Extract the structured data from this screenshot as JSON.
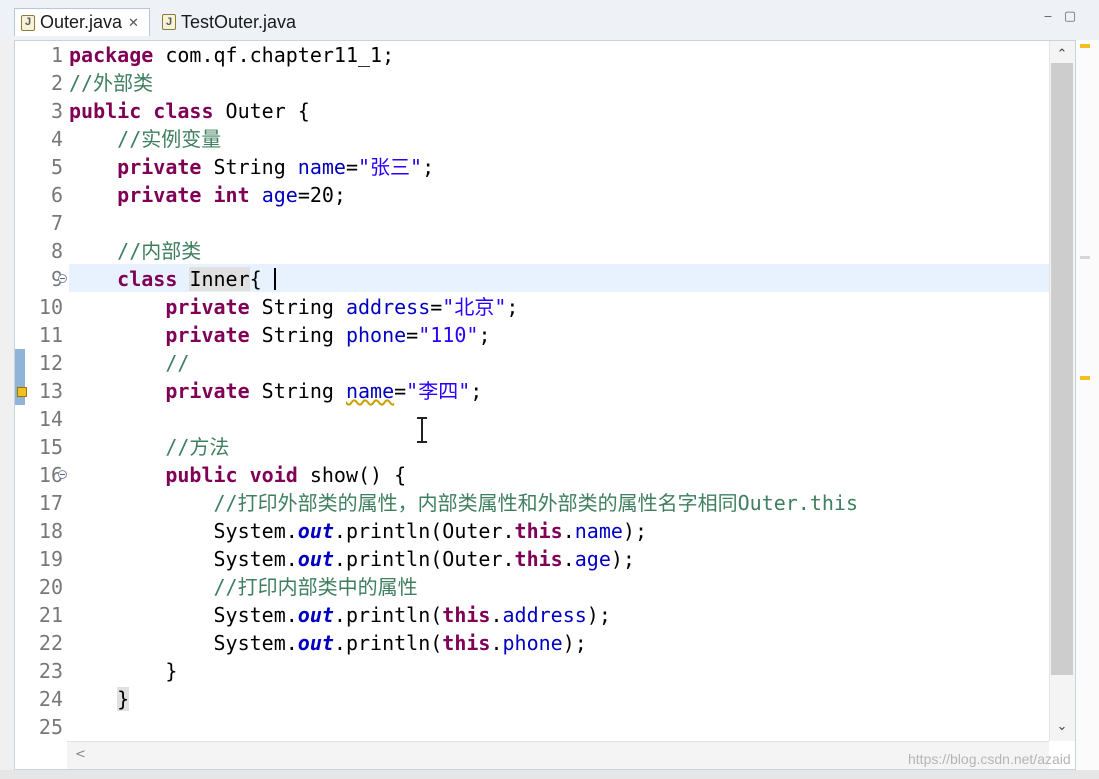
{
  "tabs": [
    {
      "label": "Outer.java",
      "active": true,
      "close_glyph": "✕"
    },
    {
      "label": "TestOuter.java",
      "active": false
    }
  ],
  "window_controls": {
    "minimize": "‒",
    "maximize": "▢"
  },
  "editor": {
    "line_numbers": [
      "1",
      "2",
      "3",
      "4",
      "5",
      "6",
      "7",
      "8",
      "9",
      "10",
      "11",
      "12",
      "13",
      "14",
      "15",
      "16",
      "17",
      "18",
      "19",
      "20",
      "21",
      "22",
      "23",
      "24",
      "25"
    ],
    "current_line": 9,
    "lines": [
      [
        {
          "t": "package",
          "c": "kw"
        },
        {
          "t": " com.qf.chapter11_1;",
          "c": ""
        }
      ],
      [
        {
          "t": "//外部类",
          "c": "cm"
        }
      ],
      [
        {
          "t": "public",
          "c": "kw"
        },
        {
          "t": " ",
          "c": ""
        },
        {
          "t": "class",
          "c": "kw"
        },
        {
          "t": " Outer {",
          "c": ""
        }
      ],
      [
        {
          "t": "    ",
          "c": ""
        },
        {
          "t": "//实例变量",
          "c": "cm"
        }
      ],
      [
        {
          "t": "    ",
          "c": ""
        },
        {
          "t": "private",
          "c": "kw"
        },
        {
          "t": " String ",
          "c": ""
        },
        {
          "t": "name",
          "c": "fd"
        },
        {
          "t": "=",
          "c": ""
        },
        {
          "t": "\"张三\"",
          "c": "st"
        },
        {
          "t": ";",
          "c": ""
        }
      ],
      [
        {
          "t": "    ",
          "c": ""
        },
        {
          "t": "private",
          "c": "kw"
        },
        {
          "t": " ",
          "c": ""
        },
        {
          "t": "int",
          "c": "kw"
        },
        {
          "t": " ",
          "c": ""
        },
        {
          "t": "age",
          "c": "fd"
        },
        {
          "t": "=20;",
          "c": ""
        }
      ],
      [],
      [
        {
          "t": "    ",
          "c": ""
        },
        {
          "t": "//内部类",
          "c": "cm"
        }
      ],
      [
        {
          "t": "    ",
          "c": ""
        },
        {
          "t": "class",
          "c": "kw"
        },
        {
          "t": " ",
          "c": ""
        },
        {
          "t": "Inner",
          "c": "hl-box"
        },
        {
          "t": "{",
          "c": ""
        }
      ],
      [
        {
          "t": "        ",
          "c": ""
        },
        {
          "t": "private",
          "c": "kw"
        },
        {
          "t": " String ",
          "c": ""
        },
        {
          "t": "address",
          "c": "fd"
        },
        {
          "t": "=",
          "c": ""
        },
        {
          "t": "\"北京\"",
          "c": "st"
        },
        {
          "t": ";",
          "c": ""
        }
      ],
      [
        {
          "t": "        ",
          "c": ""
        },
        {
          "t": "private",
          "c": "kw"
        },
        {
          "t": " String ",
          "c": ""
        },
        {
          "t": "phone",
          "c": "fd"
        },
        {
          "t": "=",
          "c": ""
        },
        {
          "t": "\"110\"",
          "c": "st"
        },
        {
          "t": ";",
          "c": ""
        }
      ],
      [
        {
          "t": "        ",
          "c": ""
        },
        {
          "t": "//",
          "c": "cm"
        }
      ],
      [
        {
          "t": "        ",
          "c": ""
        },
        {
          "t": "private",
          "c": "kw"
        },
        {
          "t": " String ",
          "c": ""
        },
        {
          "t": "name",
          "c": "fd warn"
        },
        {
          "t": "=",
          "c": ""
        },
        {
          "t": "\"李四\"",
          "c": "st"
        },
        {
          "t": ";",
          "c": ""
        }
      ],
      [],
      [
        {
          "t": "        ",
          "c": ""
        },
        {
          "t": "//方法",
          "c": "cm"
        }
      ],
      [
        {
          "t": "        ",
          "c": ""
        },
        {
          "t": "public",
          "c": "kw"
        },
        {
          "t": " ",
          "c": ""
        },
        {
          "t": "void",
          "c": "kw"
        },
        {
          "t": " show() {",
          "c": ""
        }
      ],
      [
        {
          "t": "            ",
          "c": ""
        },
        {
          "t": "//打印外部类的属性，内部类属性和外部类的属性名字相同Outer.this",
          "c": "cm"
        }
      ],
      [
        {
          "t": "            System.",
          "c": ""
        },
        {
          "t": "out",
          "c": "sf"
        },
        {
          "t": ".println(Outer.",
          "c": ""
        },
        {
          "t": "this",
          "c": "kw"
        },
        {
          "t": ".",
          "c": ""
        },
        {
          "t": "name",
          "c": "fd"
        },
        {
          "t": ");",
          "c": ""
        }
      ],
      [
        {
          "t": "            System.",
          "c": ""
        },
        {
          "t": "out",
          "c": "sf"
        },
        {
          "t": ".println(Outer.",
          "c": ""
        },
        {
          "t": "this",
          "c": "kw"
        },
        {
          "t": ".",
          "c": ""
        },
        {
          "t": "age",
          "c": "fd"
        },
        {
          "t": ");",
          "c": ""
        }
      ],
      [
        {
          "t": "            ",
          "c": ""
        },
        {
          "t": "//打印内部类中的属性",
          "c": "cm"
        }
      ],
      [
        {
          "t": "            System.",
          "c": ""
        },
        {
          "t": "out",
          "c": "sf"
        },
        {
          "t": ".println(",
          "c": ""
        },
        {
          "t": "this",
          "c": "kw"
        },
        {
          "t": ".",
          "c": ""
        },
        {
          "t": "address",
          "c": "fd"
        },
        {
          "t": ");",
          "c": ""
        }
      ],
      [
        {
          "t": "            System.",
          "c": ""
        },
        {
          "t": "out",
          "c": "sf"
        },
        {
          "t": ".println(",
          "c": ""
        },
        {
          "t": "this",
          "c": "kw"
        },
        {
          "t": ".",
          "c": ""
        },
        {
          "t": "phone",
          "c": "fd"
        },
        {
          "t": ");",
          "c": ""
        }
      ],
      [
        {
          "t": "        }",
          "c": ""
        }
      ],
      [
        {
          "t": "    ",
          "c": ""
        },
        {
          "t": "}",
          "c": "hl-box"
        }
      ],
      []
    ],
    "fold_lines": [
      9,
      16
    ],
    "change_marker_lines": [
      12,
      13
    ],
    "warning_marker_lines": [
      13
    ]
  },
  "scrollbar": {
    "up": "⌃",
    "down": "⌄",
    "left": "<"
  },
  "watermark": "https://blog.csdn.net/azaid",
  "colors": {
    "keyword": "#7f0055",
    "comment": "#3f7f5f",
    "field": "#0000c0",
    "string": "#2a00ff",
    "current_line": "#e8f2fe"
  }
}
